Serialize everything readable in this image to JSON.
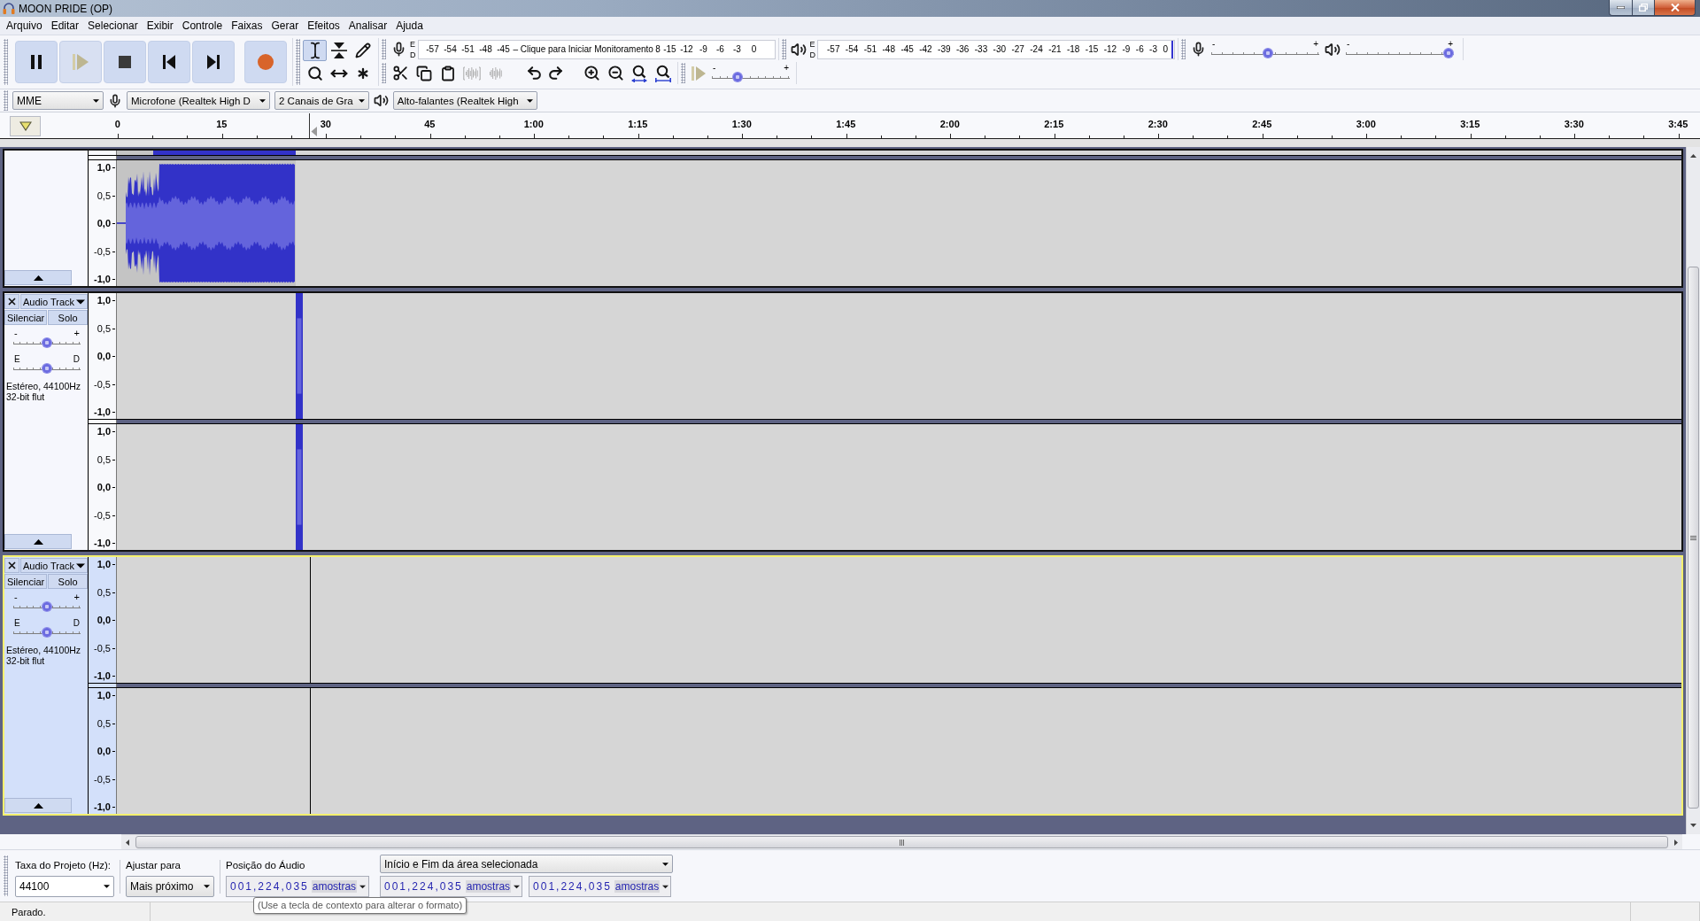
{
  "window": {
    "title": "MOON PRIDE (OP)"
  },
  "menu": [
    "Arquivo",
    "Editar",
    "Selecionar",
    "Exibir",
    "Controle",
    "Faixas",
    "Gerar",
    "Efeitos",
    "Analisar",
    "Ajuda"
  ],
  "transport": [
    {
      "kind": "pause",
      "disabled": false
    },
    {
      "kind": "play",
      "disabled": true
    },
    {
      "kind": "stop",
      "disabled": false
    },
    {
      "kind": "skip_start",
      "disabled": false
    },
    {
      "kind": "skip_end",
      "disabled": false
    },
    {
      "kind": "record",
      "disabled": false
    }
  ],
  "tools": [
    {
      "kind": "select",
      "selected": true
    },
    {
      "kind": "envelope",
      "selected": false
    },
    {
      "kind": "draw",
      "selected": false
    },
    {
      "kind": "zoom",
      "selected": false
    },
    {
      "kind": "time_shift",
      "selected": false
    },
    {
      "kind": "multi",
      "selected": false
    }
  ],
  "record_meter": {
    "channels": [
      "E",
      "D"
    ],
    "ticks_before": [
      "-57",
      "-54",
      "-51",
      "-48",
      "-45"
    ],
    "prompt": "– Clique para Iniciar Monitoramento",
    "ticks_after": [
      "8",
      "-15",
      "-12",
      "-9",
      "-6",
      "-3",
      "0"
    ]
  },
  "play_meter": {
    "channels": [
      "E",
      "D"
    ],
    "ticks": [
      "-57",
      "-54",
      "-51",
      "-48",
      "-45",
      "-42",
      "-39",
      "-36",
      "-33",
      "-30",
      "-27",
      "-24",
      "-21",
      "-18",
      "-15",
      "-12",
      "-9",
      "-6",
      "-3",
      "0"
    ],
    "peak_marker": {
      "level": 1
    }
  },
  "mixer": {
    "record_volume": {
      "min": "-",
      "max": "+",
      "level": 0.53
    },
    "play_volume": {
      "min": "-",
      "max": "+",
      "level": 1
    }
  },
  "edit_tools": [
    {
      "kind": "cut",
      "disabled": false
    },
    {
      "kind": "copy",
      "disabled": false
    },
    {
      "kind": "paste",
      "disabled": false
    },
    {
      "kind": "trim",
      "disabled": true
    },
    {
      "kind": "silence",
      "disabled": true
    },
    {
      "kind": "undo",
      "disabled": false
    },
    {
      "kind": "redo",
      "disabled": false
    },
    {
      "kind": "zoom_in",
      "disabled": false
    },
    {
      "kind": "zoom_out",
      "disabled": false
    },
    {
      "kind": "fit_selection",
      "disabled": false
    },
    {
      "kind": "fit_project",
      "disabled": false
    }
  ],
  "play_at_speed": {
    "disabled": true,
    "min": "-",
    "max": "+",
    "level": 0.3
  },
  "devices": {
    "host": "MME",
    "input": "Microfone (Realtek High D",
    "channels": "2 Canais de Gra",
    "output": "Alto-falantes (Realtek High"
  },
  "ruler": {
    "labels": [
      "0",
      "15",
      "30",
      "45",
      "1:00",
      "1:15",
      "1:30",
      "1:45",
      "2:00",
      "2:15",
      "2:30",
      "2:45",
      "3:00",
      "3:15",
      "3:30",
      "3:45"
    ]
  },
  "tracks": [
    {
      "kind": "scrolled",
      "selected": false,
      "channels": [
        {
          "kind": "music",
          "ruler": [
            "1,0",
            "0,5",
            "0,0",
            "-0,5",
            "-1,0"
          ]
        }
      ]
    },
    {
      "kind": "full",
      "selected": false,
      "name": "Audio Track",
      "mute": "Silenciar",
      "solo": "Solo",
      "gain": {
        "min": "-",
        "max": "+",
        "level": 0.5
      },
      "pan": {
        "left": "E",
        "right": "D",
        "level": 0.5
      },
      "info": [
        "Estéreo, 44100Hz",
        "32-bit flut"
      ],
      "channels": [
        {
          "kind": "blip",
          "ruler": [
            "1,0",
            "0,5",
            "0,0",
            "-0,5",
            "-1,0"
          ]
        },
        {
          "kind": "blip",
          "ruler": [
            "1,0",
            "0,5",
            "0,0",
            "-0,5",
            "-1,0"
          ]
        }
      ]
    },
    {
      "kind": "full",
      "selected": true,
      "name": "Audio Track",
      "mute": "Silenciar",
      "solo": "Solo",
      "gain": {
        "min": "-",
        "max": "+",
        "level": 0.5
      },
      "pan": {
        "left": "E",
        "right": "D",
        "level": 0.5
      },
      "info": [
        "Estéreo, 44100Hz",
        "32-bit flut"
      ],
      "channels": [
        {
          "kind": "empty",
          "ruler": [
            "1,0",
            "0,5",
            "0,0",
            "-0,5",
            "-1,0"
          ]
        },
        {
          "kind": "empty",
          "ruler": [
            "1,0",
            "0,5",
            "0,0",
            "-0,5",
            "-1,0"
          ]
        }
      ]
    }
  ],
  "selection_toolbar": {
    "rate": {
      "label": "Taxa do Projeto (Hz):",
      "value": "44100"
    },
    "snap": {
      "label": "Ajustar para",
      "value": "Mais próximo"
    },
    "position": {
      "label": "Posição do Áudio",
      "digits": "001,224,035",
      "unit": "amostras"
    },
    "range": {
      "mode": "Início e Fim da área selecionada",
      "start": {
        "digits": "001,224,035",
        "unit": "amostras"
      },
      "end": {
        "digits": "001,224,035",
        "unit": "amostras"
      }
    }
  },
  "tooltip": "(Use a tecla de contexto para alterar o formato)",
  "status": "Parado."
}
